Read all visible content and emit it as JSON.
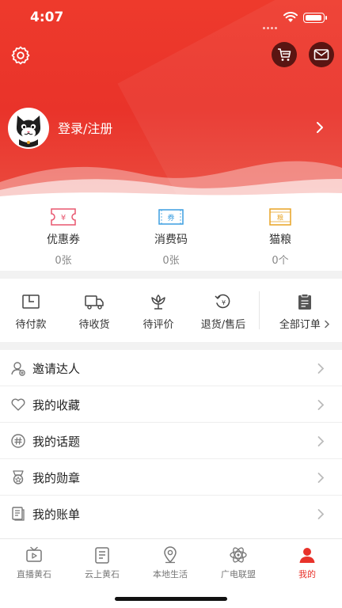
{
  "status_bar": {
    "time": "4:07"
  },
  "header": {
    "login_label": "登录/注册",
    "icons": [
      "gear-icon",
      "cart-icon",
      "mail-icon"
    ]
  },
  "wallet": [
    {
      "label": "优惠券",
      "count": "0张",
      "icon": "coupon-icon",
      "color": "#e8566f"
    },
    {
      "label": "消费码",
      "count": "0张",
      "icon": "voucher-icon",
      "color": "#3b9ee0"
    },
    {
      "label": "猫粮",
      "count": "0个",
      "icon": "cat-food-icon",
      "color": "#e8a424"
    }
  ],
  "orders": [
    {
      "label": "待付款",
      "icon": "wallet-icon"
    },
    {
      "label": "待收货",
      "icon": "truck-icon"
    },
    {
      "label": "待评价",
      "icon": "flower-icon"
    },
    {
      "label": "退货/售后",
      "icon": "refund-icon"
    },
    {
      "label": "全部订单",
      "icon": "clipboard-icon"
    }
  ],
  "menu": [
    {
      "label": "邀请达人",
      "icon": "invite-icon"
    },
    {
      "label": "我的收藏",
      "icon": "heart-icon"
    },
    {
      "label": "我的话题",
      "icon": "hashtag-icon"
    },
    {
      "label": "我的勋章",
      "icon": "medal-icon"
    },
    {
      "label": "我的账单",
      "icon": "bill-icon"
    }
  ],
  "tabs": [
    {
      "label": "直播黄石",
      "icon": "tv-icon",
      "active": false
    },
    {
      "label": "云上黄石",
      "icon": "document-icon",
      "active": false
    },
    {
      "label": "本地生活",
      "icon": "location-icon",
      "active": false
    },
    {
      "label": "广电联盟",
      "icon": "atom-icon",
      "active": false
    },
    {
      "label": "我的",
      "icon": "person-icon",
      "active": true
    }
  ],
  "colors": {
    "brand_red": "#e8322a",
    "dark_button": "#5a1512"
  }
}
